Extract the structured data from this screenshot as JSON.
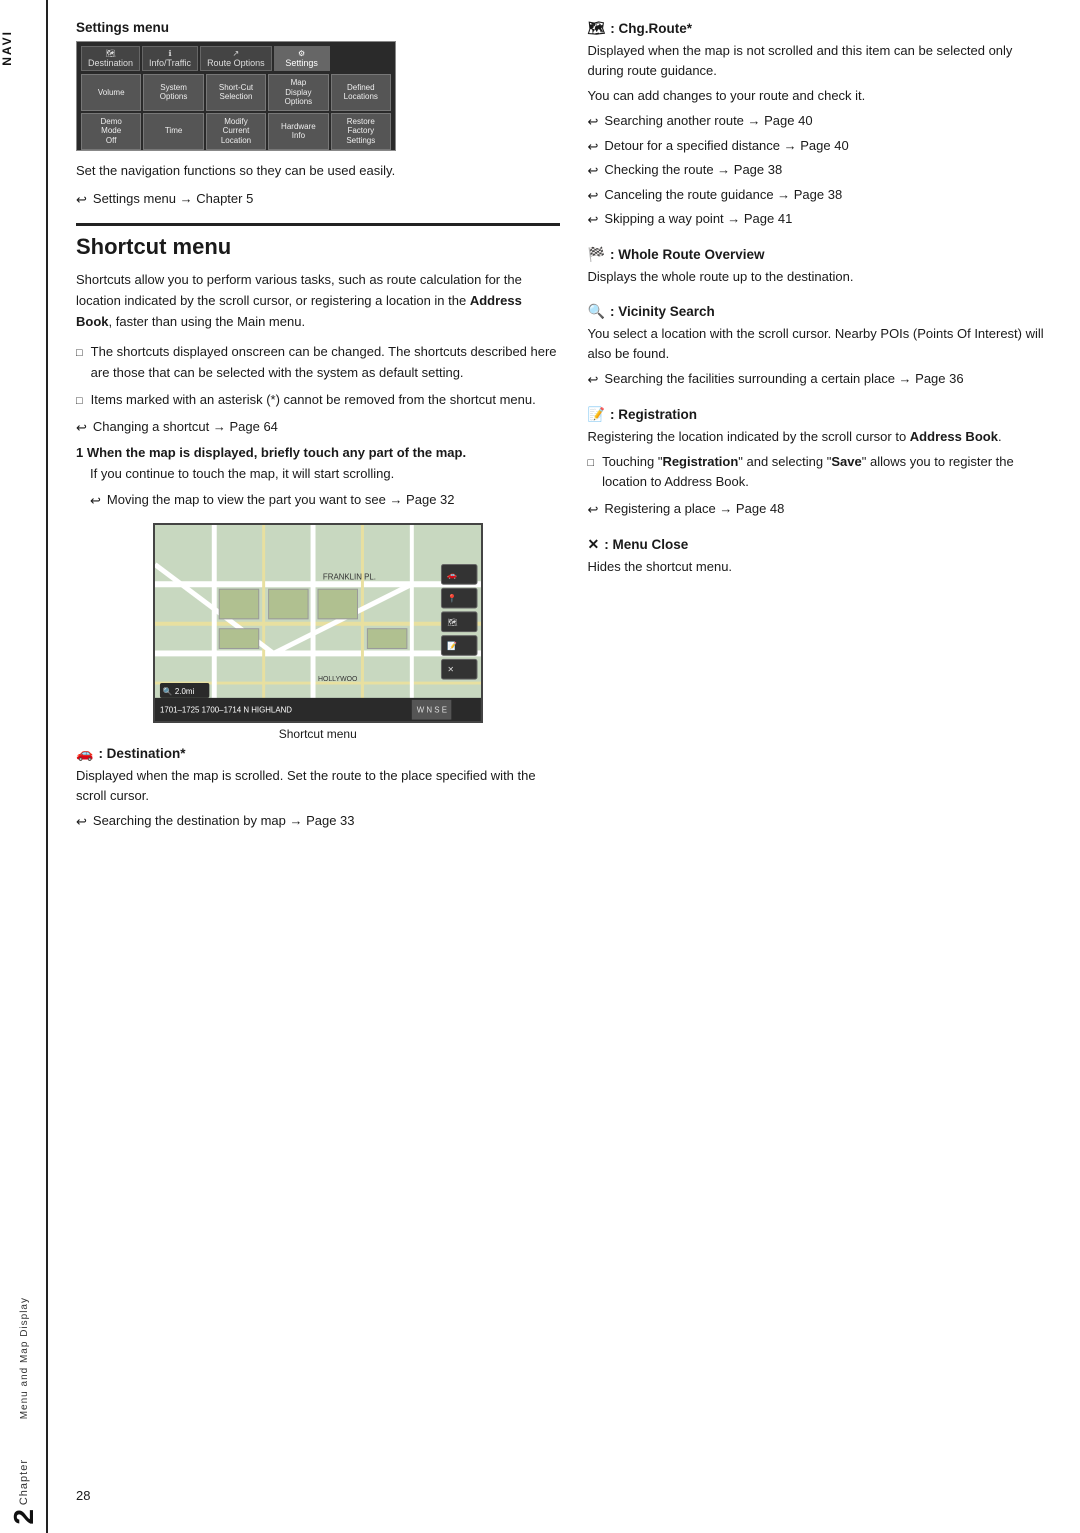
{
  "sidebar": {
    "navi_label": "NAVI",
    "chapter_label": "Chapter",
    "chapter_num": "2",
    "map_display_label": "Menu and Map Display"
  },
  "settings_section": {
    "title": "Settings menu",
    "tabs": [
      {
        "label": "Destination",
        "icon": "🗺"
      },
      {
        "label": "Info/Traffic",
        "icon": "ℹ"
      },
      {
        "label": "Route Options",
        "icon": "↗"
      },
      {
        "label": "Settings",
        "icon": "⚙"
      }
    ],
    "cells": [
      "Volume",
      "System\nOptions",
      "Short-Cut\nSelection",
      "Map\nDisplay\nOptions",
      "Defined\nLocations",
      "Demo\nMode\nOff",
      "Time",
      "Modify\nCurrent\nLocation",
      "Hardware\nInfo",
      "Restore\nFactory\nSettings"
    ],
    "desc": "Set the navigation functions so they can be used easily.",
    "arrow_item": "Settings menu → Chapter 5"
  },
  "shortcut_section": {
    "heading": "Shortcut menu",
    "body": "Shortcuts allow you to perform various tasks, such as route calculation for the location indicated by the scroll cursor, or registering a location in the Address Book, faster than using the Main menu.",
    "bullets": [
      "The shortcuts displayed onscreen can be changed. The shortcuts described here are those that can be selected with the system as default setting.",
      "Items marked with an asterisk (*) cannot be removed from the shortcut menu."
    ],
    "arrow_item": "Changing a shortcut → Page 64",
    "step1_label": "1  When the map is displayed, briefly touch any part of the map.",
    "step1_body": "If you continue to touch the map, it will start scrolling.",
    "step1_arrow": "Moving the map to view the part you want to see → Page 32",
    "map_caption": "Shortcut menu",
    "destination_title": "🚗 : Destination*",
    "destination_body": "Displayed when the map is scrolled. Set the route to the place specified with the scroll cursor.",
    "destination_arrow": "Searching the destination by map → Page 33"
  },
  "right_col": {
    "chg_route_title": ": Chg.Route*",
    "chg_route_body": "Displayed when the map is not scrolled and this item can be selected only during route guidance.",
    "chg_route_body2": "You can add changes to your route and check it.",
    "chg_route_arrows": [
      "Searching another route → Page 40",
      "Detour for a specified distance → Page 40",
      "Checking the route → Page 38",
      "Canceling the route guidance → Page 38",
      "Skipping a way point → Page 41"
    ],
    "whole_route_title": ": Whole Route Overview",
    "whole_route_body": "Displays the whole route up to the destination.",
    "vicinity_title": ": Vicinity Search",
    "vicinity_body": "You select a location with the scroll cursor. Nearby POIs (Points Of Interest) will also be found.",
    "vicinity_arrow": "Searching the facilities surrounding a certain place → Page 36",
    "registration_title": ": Registration",
    "registration_body": "Registering the location indicated by the scroll cursor to Address Book.",
    "registration_bullet": "Touching \"Registration\" and selecting \"Save\" allows you to register the location to Address Book.",
    "registration_arrow": "Registering a place → Page 48",
    "menu_close_title": ": Menu Close",
    "menu_close_body": "Hides the shortcut menu."
  },
  "page_number": "28"
}
